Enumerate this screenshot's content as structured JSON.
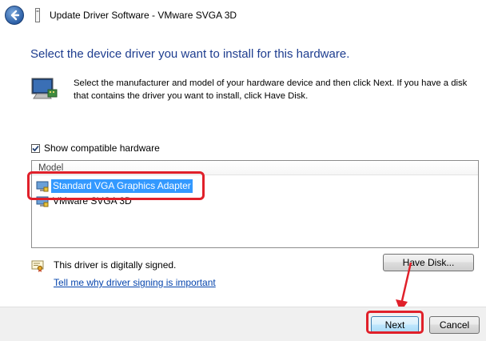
{
  "window": {
    "title": "Update Driver Software - VMware SVGA 3D"
  },
  "main": {
    "heading": "Select the device driver you want to install for this hardware.",
    "description": "Select the manufacturer and model of your hardware device and then click Next. If you have a disk that contains the driver you want to install, click Have Disk.",
    "show_compatible_label": "Show compatible hardware",
    "show_compatible_checked": true,
    "model_header": "Model",
    "models": [
      {
        "label": "Standard VGA Graphics Adapter",
        "selected": true,
        "icon": "display-adapter-icon"
      },
      {
        "label": "VMware SVGA 3D",
        "selected": false,
        "icon": "display-adapter-icon"
      }
    ],
    "signed_text": "This driver is digitally signed.",
    "signing_link": "Tell me why driver signing is important",
    "have_disk_label": "Have Disk..."
  },
  "footer": {
    "next_label": "Next",
    "cancel_label": "Cancel"
  },
  "colors": {
    "heading": "#1e3d8f",
    "selection": "#3399ff",
    "annotation": "#e0202a",
    "link": "#0645ad"
  }
}
